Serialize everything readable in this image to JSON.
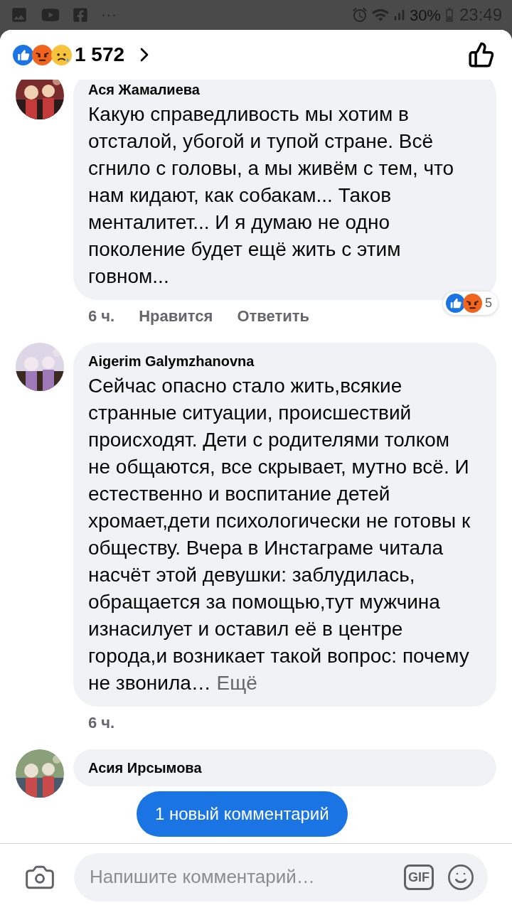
{
  "status_bar": {
    "battery": "30%",
    "time": "23:49",
    "more": "···"
  },
  "header": {
    "reactions": [
      {
        "kind": "like"
      },
      {
        "kind": "angry"
      },
      {
        "kind": "sad"
      }
    ],
    "reaction_count": "1 572"
  },
  "comments": [
    {
      "author": "Ася Жамалиева",
      "text": "Какую справедливость мы хотим в отсталой, убогой и тупой стране. Всё сгнило с головы, а мы живём с тем, что нам кидают, как собакам... Таков менталитет... И я думаю не одно поколение будет ещё жить с этим говном...",
      "time": "6 ч.",
      "actions": [
        "Нравится",
        "Ответить"
      ],
      "reactions": [
        {
          "kind": "like"
        },
        {
          "kind": "angry"
        }
      ],
      "reaction_count": "5"
    },
    {
      "author": "Aigerim Galymzhanovna",
      "text": "Сейчас опасно стало жить,всякие странные ситуации, происшествий происходят. Дети с родителями толком не общаются, все скрывает, мутно всё. И естественно и воспитание детей хромает,дети психологически не готовы к обществу. Вчера в Инстаграме читала насчёт этой девушки: заблудилась, обращается за помощью,тут мужчина изнасилует и оставил её в центре города,и возникает такой вопрос: почему не звонила…",
      "more": "Ещё",
      "time": "6 ч."
    },
    {
      "author": "Асия Ирсымова"
    }
  ],
  "new_comments_button": "1 новый комментарий",
  "composer": {
    "placeholder": "Напишите комментарий…",
    "gif": "GIF"
  }
}
